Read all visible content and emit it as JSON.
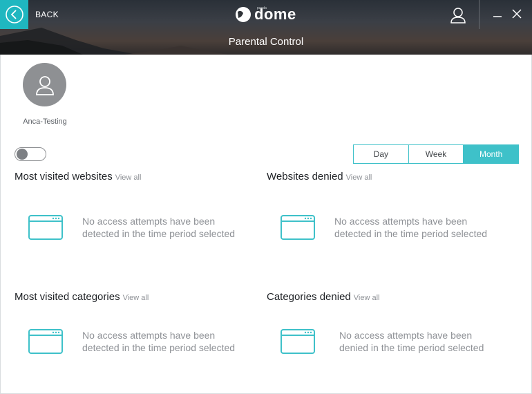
{
  "header": {
    "back_label": "BACK",
    "logo_text": "dome",
    "logo_small": "panda",
    "page_title": "Parental Control"
  },
  "profile": {
    "name": "Anca-Testing",
    "toggle_on": false
  },
  "period": {
    "options": [
      "Day",
      "Week",
      "Month"
    ],
    "selected": "Month"
  },
  "sections": {
    "most_visited_websites": {
      "title": "Most visited websites",
      "view_all": "View all",
      "empty_line1": "No access attempts have been",
      "empty_line2": "detected in the time period selected"
    },
    "websites_denied": {
      "title": "Websites denied",
      "view_all": "View all",
      "empty_line1": "No access attempts have been",
      "empty_line2": "detected in the time period selected"
    },
    "most_visited_categories": {
      "title": "Most visited categories",
      "view_all": "View all",
      "empty_line1": "No access attempts have been",
      "empty_line2": "detected in the time period selected"
    },
    "categories_denied": {
      "title": "Categories denied",
      "view_all": "View all",
      "empty_line1": "No access attempts have been",
      "empty_line2": "denied in the time period selected"
    }
  },
  "colors": {
    "accent": "#3ec1c9",
    "back_button": "#1fb7c0",
    "avatar": "#8e9093",
    "muted_text": "#8e9196"
  },
  "icons": {
    "back": "chevron-left-circle-icon",
    "user": "user-icon",
    "minimize": "minimize-icon",
    "close": "close-icon",
    "avatar": "person-icon",
    "empty_state": "browser-window-icon"
  }
}
